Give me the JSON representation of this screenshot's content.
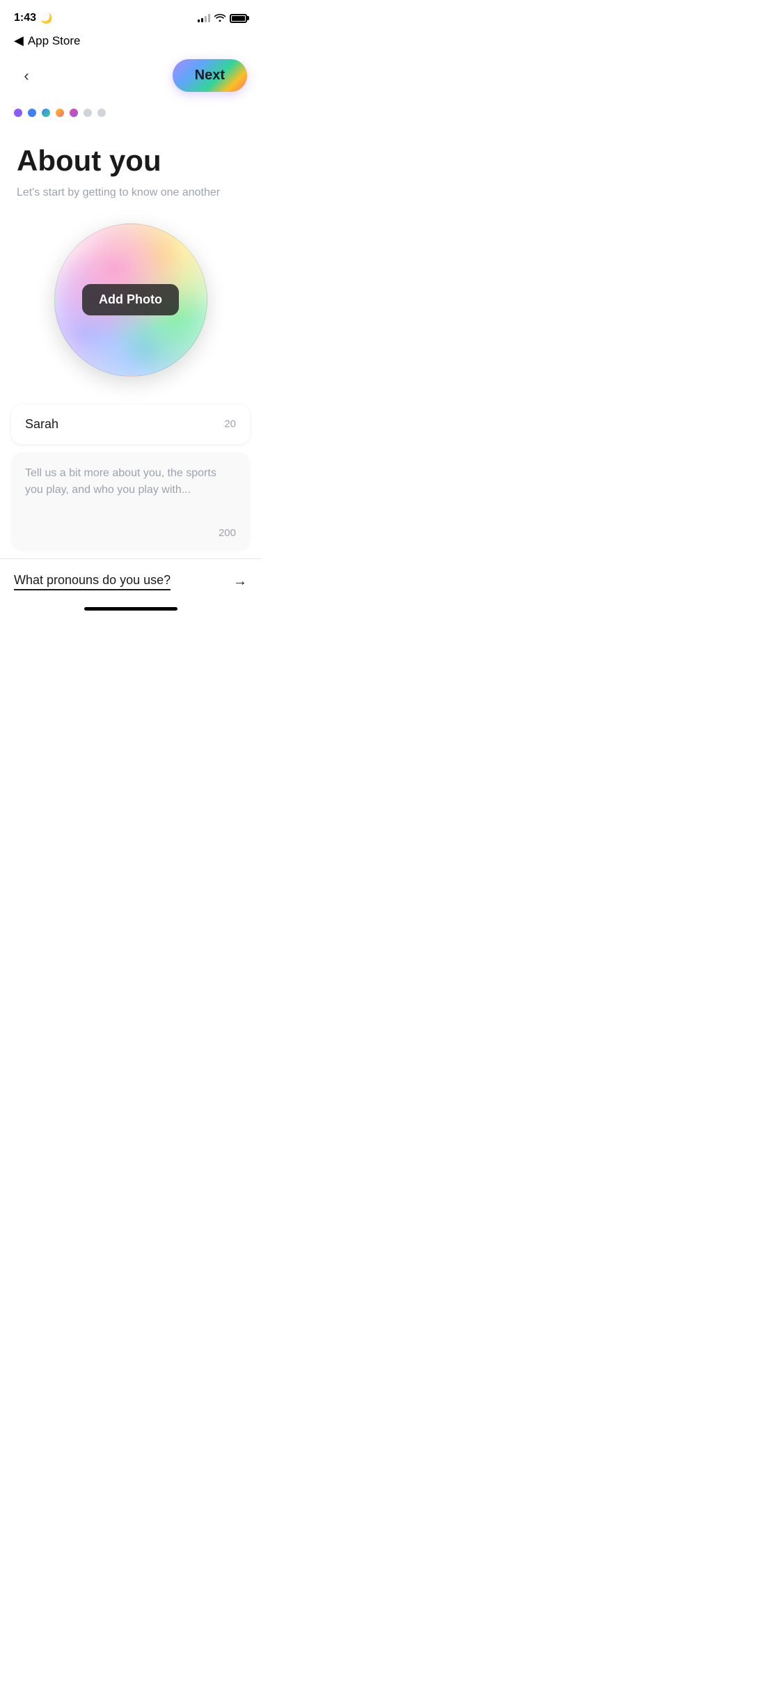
{
  "statusBar": {
    "time": "1:43",
    "moonIcon": "🌙"
  },
  "appStoreNav": {
    "backLabel": "App Store"
  },
  "navBar": {
    "backArrow": "‹",
    "nextLabel": "Next"
  },
  "progressDots": {
    "count": 7,
    "activeDots": 5
  },
  "page": {
    "title": "About you",
    "subtitle": "Let's start by getting to know one another"
  },
  "photoSection": {
    "addPhotoLabel": "Add Photo"
  },
  "nameField": {
    "value": "Sarah",
    "charCount": "20"
  },
  "bioField": {
    "placeholder": "Tell us a bit more about you, the sports you play, and who you play with...",
    "charCount": "200"
  },
  "pronounsRow": {
    "label": "What pronouns do you use?",
    "arrow": "→"
  }
}
